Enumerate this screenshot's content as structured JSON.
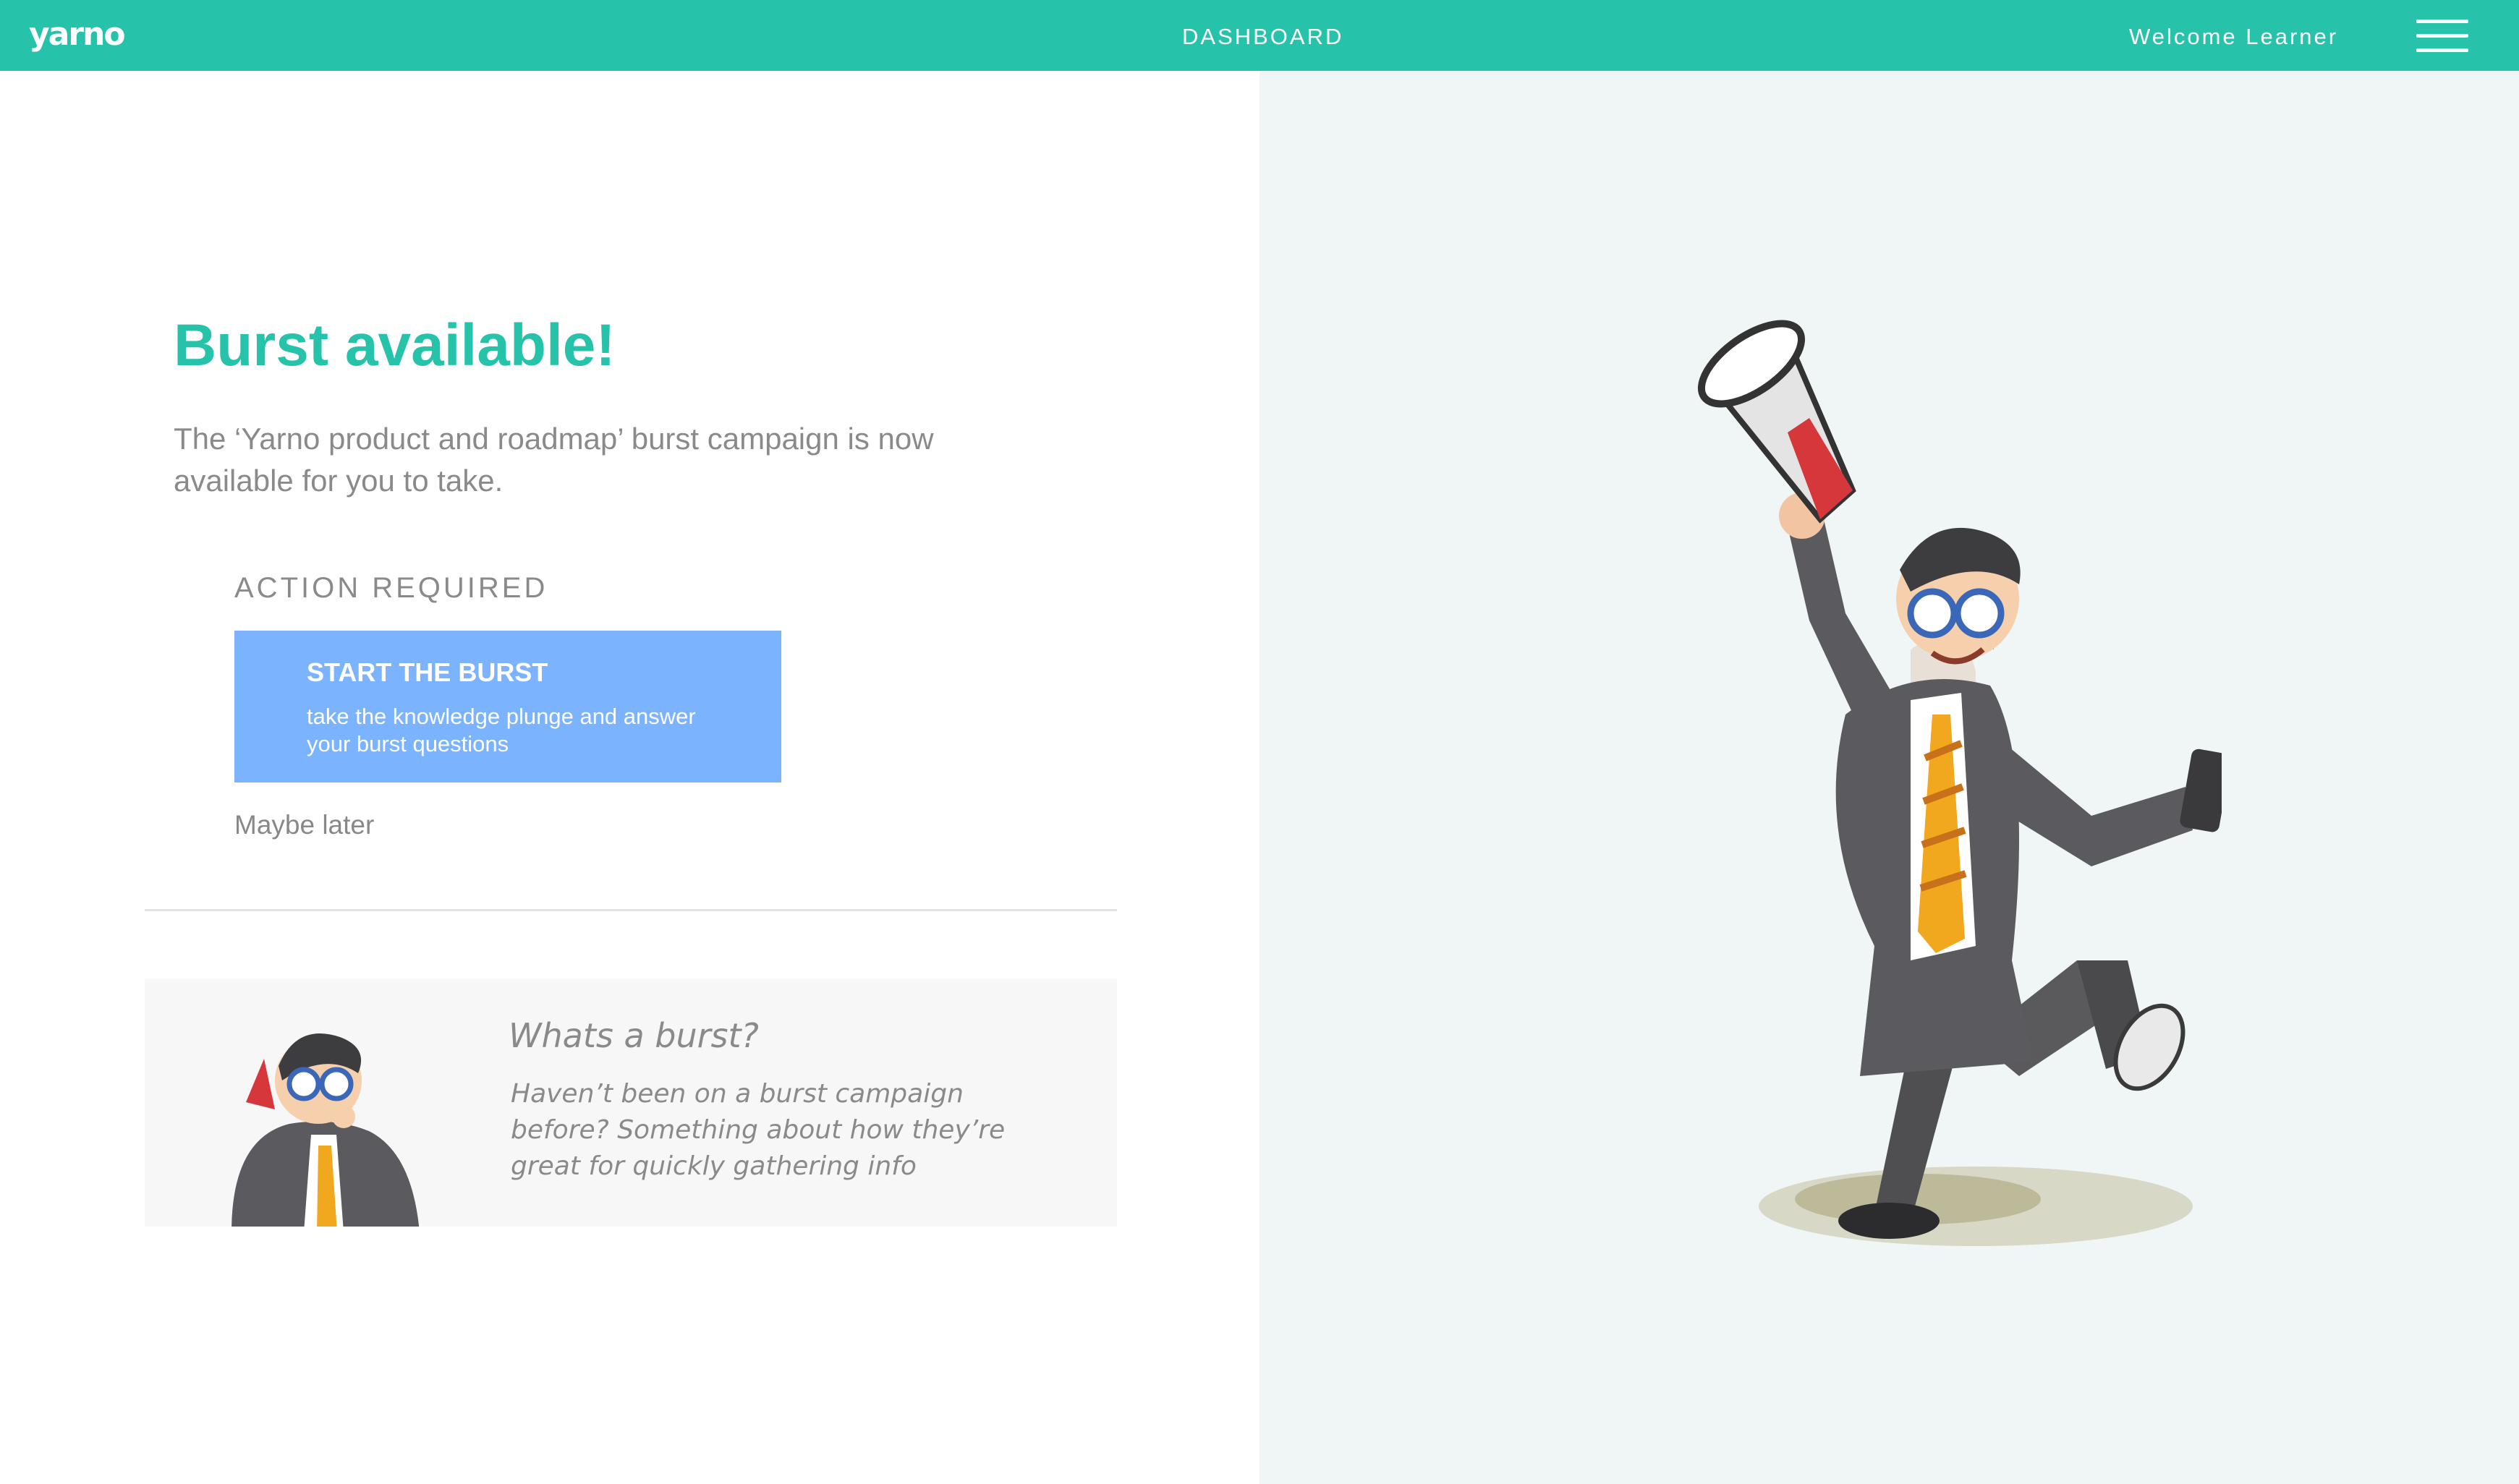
{
  "header": {
    "logo": "yarno",
    "title": "DASHBOARD",
    "welcome": "Welcome Learner",
    "menu_icon": "hamburger-menu-icon"
  },
  "main": {
    "headline": "Burst available!",
    "intro": "The ‘Yarno product and roadmap’ burst campaign is now available for you to take.",
    "action_label": "ACTION REQUIRED",
    "cta": {
      "title": "START THE BURST",
      "subtitle": "take the knowledge plunge and answer your burst questions"
    },
    "maybe_later": "Maybe later"
  },
  "info_card": {
    "title": "Whats a burst?",
    "text": "Haven’t been on a burst campaign before? Something about how they’re great for quickly gathering info"
  },
  "colors": {
    "accent": "#26c2aa",
    "cta": "#7bb3ff",
    "panel": "#f0f6f6",
    "text_muted": "#8a8a8a"
  }
}
